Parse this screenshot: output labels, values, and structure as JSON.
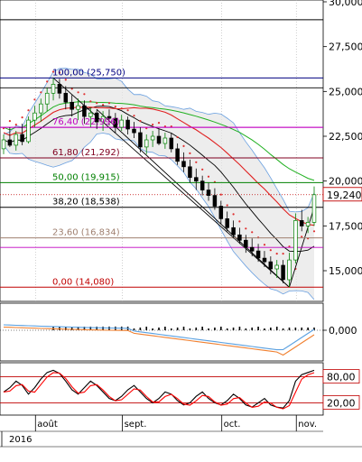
{
  "chart_data": [
    {
      "type": "candlestick",
      "price_axis": {
        "ylim": [
          13000,
          30000
        ],
        "ticks": [
          "30,000",
          "27,500",
          "25,000",
          "22,500",
          "20,000",
          "17,500",
          "15,000"
        ],
        "tick_values": [
          30000,
          27500,
          25000,
          22500,
          20000,
          17500,
          15000
        ],
        "last_price_label": "19,240",
        "last_price": 19240
      },
      "time_axis": {
        "months": [
          "août",
          "sept.",
          "oct.",
          "nov."
        ],
        "year": "2016"
      },
      "fibonacci_levels": [
        {
          "label": "100,00 (25,750)",
          "value": 25750,
          "color": "#000080"
        },
        {
          "label": "76,40 (22,996)",
          "value": 22996,
          "color": "#c000c0"
        },
        {
          "label": "61,80 (21,292)",
          "value": 21292,
          "color": "#800020"
        },
        {
          "label": "50,00 (19,915)",
          "value": 19915,
          "color": "#008000"
        },
        {
          "label": "38,20 (18,538)",
          "value": 18538,
          "color": "#000000"
        },
        {
          "label": "23,60 (16,834)",
          "value": 16834,
          "color": "#a08070"
        },
        {
          "label": "0,00 (14,080)",
          "value": 14080,
          "color": "#c00000"
        }
      ],
      "ohlc": [
        [
          21.8,
          22.6,
          21.5,
          22.3
        ],
        [
          22.3,
          23.0,
          21.9,
          22.0
        ],
        [
          22.0,
          22.8,
          21.7,
          22.6
        ],
        [
          22.6,
          23.2,
          22.0,
          22.2
        ],
        [
          22.2,
          23.6,
          22.1,
          23.4
        ],
        [
          23.4,
          24.2,
          23.0,
          23.8
        ],
        [
          23.8,
          24.6,
          23.3,
          24.3
        ],
        [
          24.3,
          25.2,
          23.9,
          24.9
        ],
        [
          24.9,
          25.75,
          24.5,
          25.4
        ],
        [
          25.4,
          25.7,
          24.6,
          24.9
        ],
        [
          24.9,
          25.3,
          24.0,
          24.4
        ],
        [
          24.4,
          24.8,
          23.6,
          24.0
        ],
        [
          24.0,
          24.6,
          23.4,
          24.2
        ],
        [
          24.2,
          24.5,
          23.2,
          23.6
        ],
        [
          23.6,
          24.1,
          23.0,
          23.8
        ],
        [
          23.8,
          24.0,
          22.9,
          23.3
        ],
        [
          23.3,
          23.9,
          22.8,
          23.6
        ],
        [
          23.6,
          24.0,
          23.1,
          23.5
        ],
        [
          23.5,
          23.8,
          22.7,
          23.0
        ],
        [
          23.0,
          23.7,
          22.8,
          23.4
        ],
        [
          23.4,
          23.6,
          22.6,
          22.9
        ],
        [
          22.9,
          23.3,
          22.4,
          22.7
        ],
        [
          22.7,
          23.0,
          21.6,
          21.9
        ],
        [
          21.9,
          22.6,
          21.5,
          22.3
        ],
        [
          22.3,
          22.8,
          21.9,
          22.5
        ],
        [
          22.5,
          22.9,
          22.0,
          22.1
        ],
        [
          22.1,
          22.7,
          21.8,
          22.4
        ],
        [
          22.4,
          22.7,
          21.6,
          21.8
        ],
        [
          21.8,
          22.1,
          20.9,
          21.1
        ],
        [
          21.1,
          21.6,
          20.5,
          20.8
        ],
        [
          20.8,
          21.2,
          19.9,
          20.2
        ],
        [
          20.2,
          20.7,
          19.5,
          20.0
        ],
        [
          20.0,
          20.3,
          19.2,
          19.5
        ],
        [
          19.5,
          19.9,
          18.9,
          19.2
        ],
        [
          19.2,
          19.6,
          18.4,
          18.6
        ],
        [
          18.6,
          18.9,
          17.6,
          17.9
        ],
        [
          17.9,
          18.3,
          17.2,
          17.4
        ],
        [
          17.4,
          17.8,
          16.8,
          17.0
        ],
        [
          17.0,
          17.4,
          16.5,
          16.7
        ],
        [
          16.7,
          17.0,
          16.0,
          16.3
        ],
        [
          16.3,
          16.8,
          15.8,
          16.1
        ],
        [
          16.1,
          16.5,
          15.5,
          15.7
        ],
        [
          15.7,
          16.1,
          15.2,
          15.5
        ],
        [
          15.5,
          15.8,
          14.8,
          15.1
        ],
        [
          15.1,
          15.6,
          14.6,
          15.3
        ],
        [
          15.3,
          15.6,
          14.3,
          14.5
        ],
        [
          14.5,
          16.0,
          14.08,
          15.6
        ],
        [
          15.6,
          18.2,
          15.4,
          17.8
        ],
        [
          17.8,
          18.4,
          17.2,
          17.5
        ],
        [
          17.5,
          18.0,
          17.1,
          17.7
        ],
        [
          17.7,
          19.7,
          17.5,
          19.24
        ]
      ],
      "indicators": [
        "bollinger_bands",
        "moving_averages",
        "parabolic_sar"
      ]
    },
    {
      "type": "line",
      "name": "macd",
      "ticks": [
        "0,000"
      ],
      "tick_values": [
        0
      ]
    },
    {
      "type": "line",
      "name": "stochastic",
      "ylim": [
        0,
        100
      ],
      "ticks": [
        "80,00",
        "20,00"
      ],
      "tick_values": [
        80,
        20
      ]
    }
  ],
  "colors": {
    "up": "#008000",
    "down": "#000000",
    "bb_fill": "#e6e6e6",
    "ma_red": "#e02020",
    "ma_green": "#20b020",
    "ma_black": "#000000",
    "ma_blue": "#6aa0e0",
    "sar": "#e03030",
    "osc_black": "#000000",
    "osc_red": "#ff0000",
    "macd_blue": "#5aa0e0",
    "macd_orange": "#f08030"
  }
}
